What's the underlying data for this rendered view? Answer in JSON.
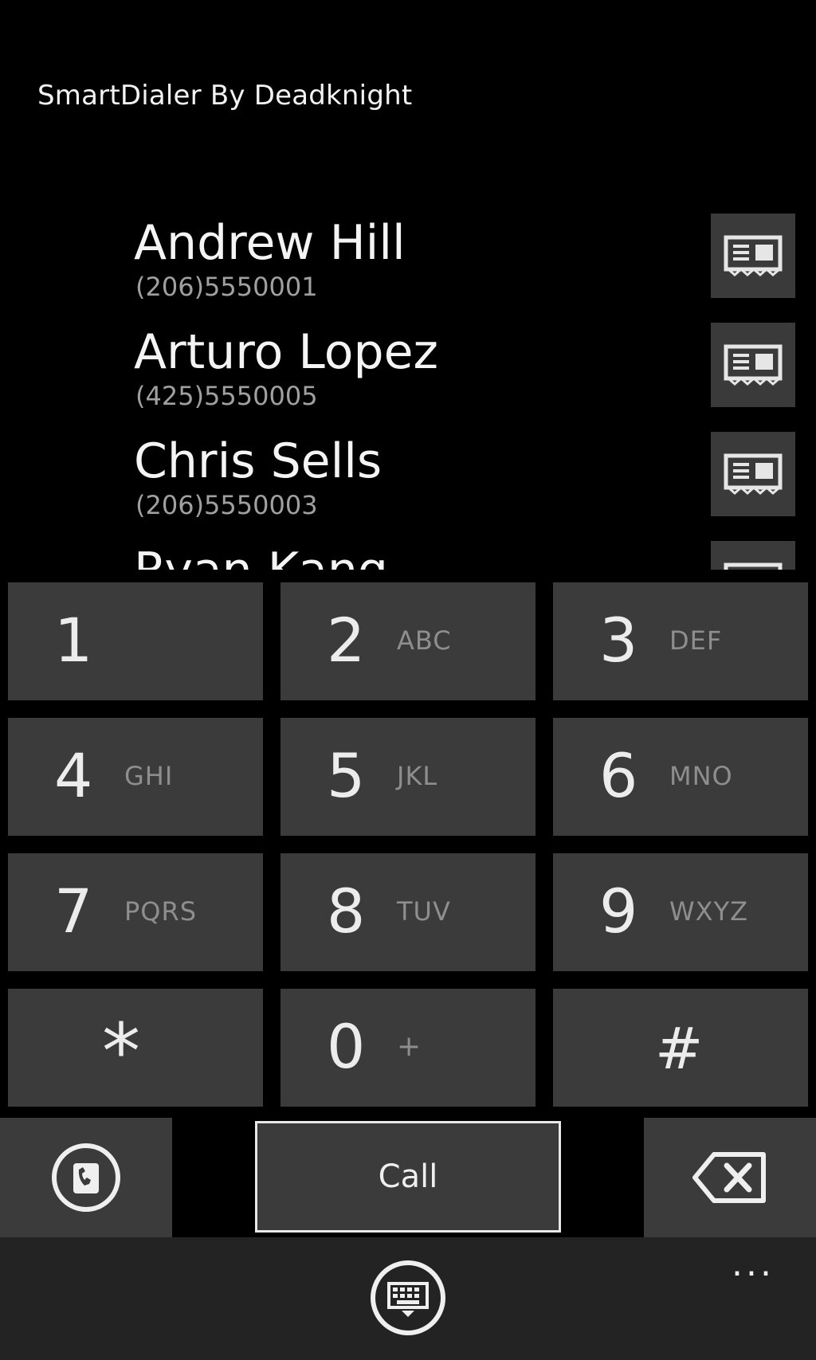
{
  "app": {
    "title": "SmartDialer By Deadknight"
  },
  "contacts": [
    {
      "name": "Andrew Hill",
      "number": "(206)5550001",
      "icon": "contact-card-icon"
    },
    {
      "name": "Arturo Lopez",
      "number": "(425)5550005",
      "icon": "contact-card-icon"
    },
    {
      "name": "Chris Sells",
      "number": "(206)5550003",
      "icon": "contact-card-icon"
    },
    {
      "name": "Ryan Kang",
      "number": "",
      "icon": "contact-card-icon"
    }
  ],
  "keypad": {
    "keys": [
      {
        "digit": "1",
        "letters": ""
      },
      {
        "digit": "2",
        "letters": "ABC"
      },
      {
        "digit": "3",
        "letters": "DEF"
      },
      {
        "digit": "4",
        "letters": "GHI"
      },
      {
        "digit": "5",
        "letters": "JKL"
      },
      {
        "digit": "6",
        "letters": "MNO"
      },
      {
        "digit": "7",
        "letters": "PQRS"
      },
      {
        "digit": "8",
        "letters": "TUV"
      },
      {
        "digit": "9",
        "letters": "WXYZ"
      },
      {
        "digit": "*",
        "letters": ""
      },
      {
        "digit": "0",
        "letters": "+"
      },
      {
        "digit": "#",
        "letters": ""
      }
    ]
  },
  "actions": {
    "call_label": "Call",
    "left_icon": "phone-icon",
    "right_icon": "backspace-icon"
  },
  "app_bar": {
    "more_label": "...",
    "center_icon": "keyboard-icon"
  },
  "colors": {
    "background": "#000000",
    "key_background": "#3b3b3b",
    "app_bar_background": "#232323",
    "secondary_text": "#a0a0a0"
  }
}
